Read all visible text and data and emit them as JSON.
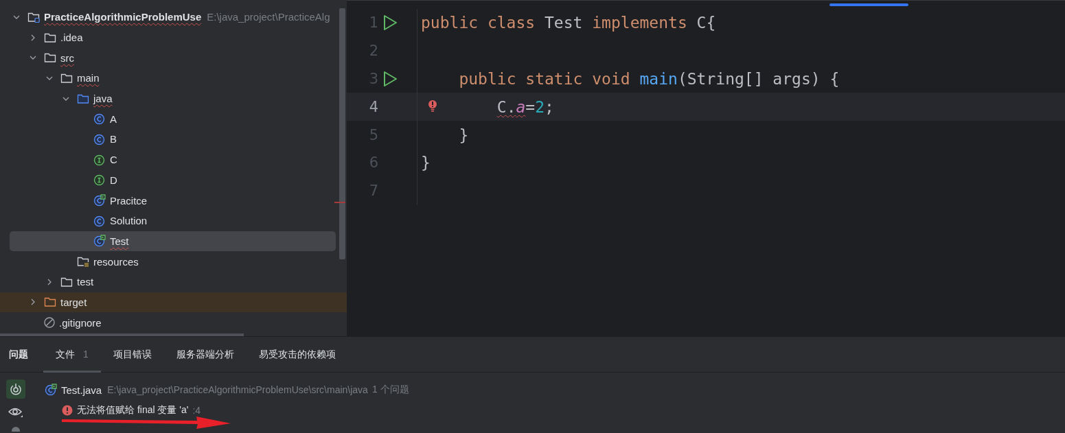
{
  "project_tree": {
    "items": [
      {
        "name": "PracticeAlgorithmicProblemUse",
        "path": "E:\\java_project\\PracticeAlg",
        "kind": "project",
        "expanded": true,
        "selected": false,
        "error": true,
        "children": [
          {
            "name": ".idea",
            "kind": "folder",
            "expanded": false,
            "selected": false,
            "error": false
          },
          {
            "name": "src",
            "kind": "folder",
            "expanded": true,
            "selected": false,
            "error": true,
            "children": [
              {
                "name": "main",
                "kind": "folder",
                "expanded": true,
                "selected": false,
                "error": true,
                "children": [
                  {
                    "name": "java",
                    "kind": "source-folder",
                    "expanded": true,
                    "selected": false,
                    "error": true,
                    "children": [
                      {
                        "name": "A",
                        "kind": "class",
                        "selected": false,
                        "error": false
                      },
                      {
                        "name": "B",
                        "kind": "class",
                        "selected": false,
                        "error": false
                      },
                      {
                        "name": "C",
                        "kind": "interface",
                        "selected": false,
                        "error": false
                      },
                      {
                        "name": "D",
                        "kind": "interface",
                        "selected": false,
                        "error": false
                      },
                      {
                        "name": "Pracitce",
                        "kind": "runnable-class",
                        "selected": false,
                        "error": false
                      },
                      {
                        "name": "Solution",
                        "kind": "class",
                        "selected": false,
                        "error": false
                      },
                      {
                        "name": "Test",
                        "kind": "runnable-class",
                        "selected": true,
                        "error": true
                      }
                    ]
                  },
                  {
                    "name": "resources",
                    "kind": "resources-folder",
                    "selected": false,
                    "error": false
                  }
                ]
              },
              {
                "name": "test",
                "kind": "folder",
                "expanded": false,
                "selected": false,
                "error": false
              }
            ]
          },
          {
            "name": "target",
            "kind": "excluded-folder",
            "expanded": false,
            "selected": false,
            "error": false
          },
          {
            "name": ".gitignore",
            "kind": "ignored-file",
            "selected": false,
            "error": false
          }
        ]
      }
    ]
  },
  "editor": {
    "lines": [
      {
        "number": "1",
        "runnable": true,
        "current": false,
        "error_marker": false,
        "tokens": [
          {
            "text": "public class ",
            "kind": "keyword"
          },
          {
            "text": "Test ",
            "kind": "plain"
          },
          {
            "text": "implements ",
            "kind": "keyword"
          },
          {
            "text": "C{",
            "kind": "plain"
          }
        ]
      },
      {
        "number": "2",
        "runnable": false,
        "current": false,
        "error_marker": false
      },
      {
        "number": "3",
        "runnable": true,
        "current": false,
        "error_marker": false,
        "tokens": [
          {
            "text": "    public static void ",
            "kind": "keyword"
          },
          {
            "text": "main",
            "kind": "method"
          },
          {
            "text": "(String[] args) {",
            "kind": "plain"
          }
        ]
      },
      {
        "number": "4",
        "runnable": false,
        "current": true,
        "error_marker": true,
        "tokens": [
          {
            "text": "        C.",
            "kind": "plain",
            "error": true
          },
          {
            "text": "a",
            "kind": "field",
            "error": true
          },
          {
            "text": "=",
            "kind": "plain"
          },
          {
            "text": "2",
            "kind": "number"
          },
          {
            "text": ";",
            "kind": "plain"
          }
        ]
      },
      {
        "number": "5",
        "runnable": false,
        "current": false,
        "error_marker": false,
        "tokens": [
          {
            "text": "    }",
            "kind": "plain"
          }
        ]
      },
      {
        "number": "6",
        "runnable": false,
        "current": false,
        "error_marker": false,
        "tokens": [
          {
            "text": "}",
            "kind": "plain"
          }
        ]
      },
      {
        "number": "7",
        "runnable": false,
        "current": false,
        "error_marker": false
      }
    ]
  },
  "problems": {
    "title": "问题",
    "tabs": [
      {
        "label": "文件",
        "count": "1",
        "selected": true
      },
      {
        "label": "项目错误",
        "selected": false
      },
      {
        "label": "服务器端分析",
        "selected": false
      },
      {
        "label": "易受攻击的依赖项",
        "selected": false
      }
    ],
    "side_tools": [
      {
        "kind": "autoscroll",
        "selected": true
      },
      {
        "kind": "preview",
        "selected": false
      },
      {
        "kind": "more",
        "selected": false
      }
    ],
    "file": {
      "name": "Test.java",
      "path": "E:\\java_project\\PracticeAlgorithmicProblemUse\\src\\main\\java",
      "summary": "1 个问题"
    },
    "problem": {
      "message": "无法将值赋给 final 变量 'a'",
      "line": ":4"
    }
  }
}
